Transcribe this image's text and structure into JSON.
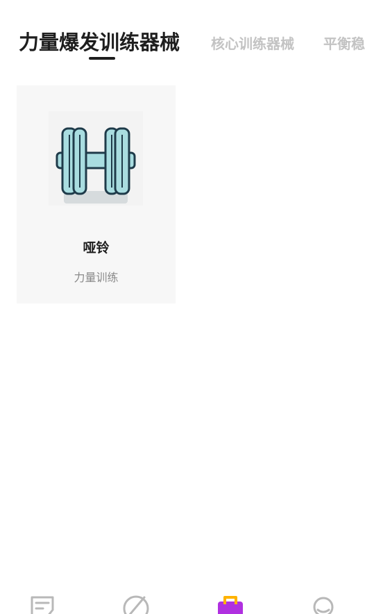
{
  "tabs": [
    {
      "label": "力量爆发训练器械",
      "active": true
    },
    {
      "label": "核心训练器械",
      "active": false
    },
    {
      "label": "平衡稳",
      "active": false
    }
  ],
  "products": [
    {
      "name": "哑铃",
      "category": "力量训练",
      "icon": "dumbbell-icon"
    }
  ],
  "bottom_nav": [
    {
      "icon": "notes-icon",
      "active": false
    },
    {
      "icon": "discover-icon",
      "active": false
    },
    {
      "icon": "shop-bag-icon",
      "active": true
    },
    {
      "icon": "profile-icon",
      "active": false
    }
  ],
  "colors": {
    "active_text": "#1e1e1e",
    "inactive_text": "#c3c3c3",
    "card_bg": "#f7f7f7",
    "subtitle": "#8a8a8a",
    "nav_icon": "#b8b8b8",
    "nav_active_primary": "#b030e0",
    "nav_active_accent": "#ffb300",
    "dumbbell_fill": "#a9dde0",
    "dumbbell_stroke": "#1f3b4a"
  }
}
